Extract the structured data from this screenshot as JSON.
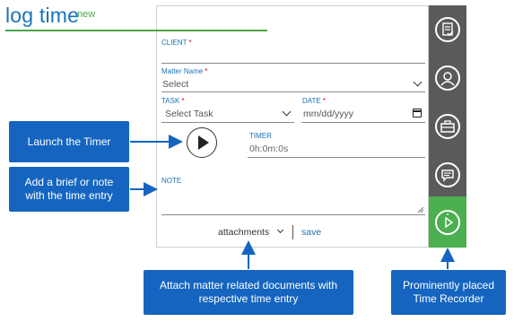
{
  "form": {
    "title": "log time",
    "badge": "new",
    "client": {
      "label": "CLIENT",
      "required": "*"
    },
    "matter": {
      "label": "Matter Name",
      "required": "*",
      "value": "Select"
    },
    "task": {
      "label": "TASK",
      "required": "*",
      "value": "Select Task"
    },
    "date": {
      "label": "DATE",
      "required": "*",
      "placeholder": "mm/dd/yyyy"
    },
    "timer": {
      "label": "TIMER",
      "value": "0h:0m:0s"
    },
    "note": {
      "label": "NOTE"
    },
    "footer": {
      "attachments": "attachments",
      "save": "save"
    }
  },
  "rail": {
    "items": [
      {
        "icon": "checklist-icon"
      },
      {
        "icon": "user-icon"
      },
      {
        "icon": "briefcase-icon"
      },
      {
        "icon": "chat-icon"
      },
      {
        "icon": "timer-icon",
        "active": true
      }
    ]
  },
  "callouts": {
    "launch_timer": "Launch the Timer",
    "add_note": "Add a brief or note with the time entry",
    "attach_docs": "Attach matter related documents with respective time entry",
    "time_recorder": "Prominently placed Time Recorder"
  },
  "colors": {
    "accent": "#1a73b8",
    "green": "#49a845",
    "rail": "#5a5a5a",
    "callout": "#1565c0",
    "required": "#d0021b"
  }
}
